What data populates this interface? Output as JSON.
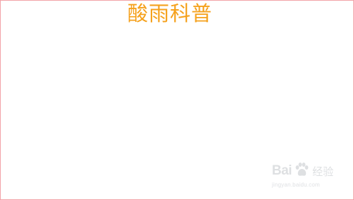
{
  "slide": {
    "title": "酸雨科普"
  },
  "colors": {
    "title": "#f5a11c",
    "frame_border": "#f2a3a8",
    "watermark": "#c4c7cc"
  },
  "watermark": {
    "brand_text": "Bai",
    "icon": "baidu-paw-icon",
    "product_text": "经验",
    "url": "jingyan.baidu.com"
  }
}
